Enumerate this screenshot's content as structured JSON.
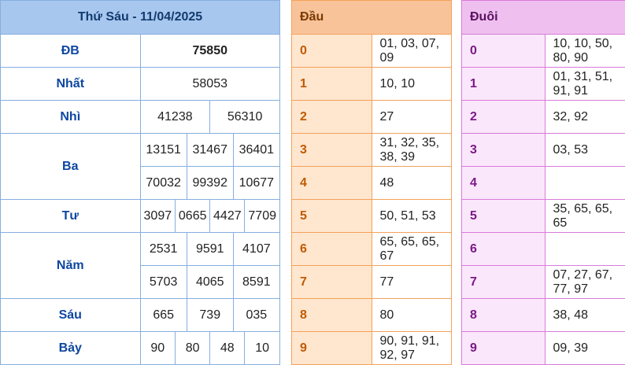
{
  "header": {
    "title": "Thứ Sáu - 11/04/2025"
  },
  "prizes": {
    "db": {
      "label": "ĐB",
      "values": [
        "75850"
      ]
    },
    "nhat": {
      "label": "Nhất",
      "values": [
        "58053"
      ]
    },
    "nhi": {
      "label": "Nhì",
      "values": [
        "41238",
        "56310"
      ]
    },
    "ba": {
      "label": "Ba",
      "values": [
        "13151",
        "31467",
        "36401",
        "70032",
        "99392",
        "10677"
      ]
    },
    "tu": {
      "label": "Tư",
      "values": [
        "3097",
        "0665",
        "4427",
        "7709"
      ]
    },
    "nam": {
      "label": "Năm",
      "values": [
        "2531",
        "9591",
        "4107",
        "5703",
        "4065",
        "8591"
      ]
    },
    "sau": {
      "label": "Sáu",
      "values": [
        "665",
        "739",
        "035"
      ]
    },
    "bay": {
      "label": "Bảy",
      "values": [
        "90",
        "80",
        "48",
        "10"
      ]
    }
  },
  "dau": {
    "title": "Đầu",
    "rows": [
      {
        "key": "0",
        "nums": "01, 03, 07, 09"
      },
      {
        "key": "1",
        "nums": "10, 10"
      },
      {
        "key": "2",
        "nums": "27"
      },
      {
        "key": "3",
        "nums": "31, 32, 35, 38, 39"
      },
      {
        "key": "4",
        "nums": "48"
      },
      {
        "key": "5",
        "nums": "50, 51, 53"
      },
      {
        "key": "6",
        "nums": "65, 65, 65, 67"
      },
      {
        "key": "7",
        "nums": "77"
      },
      {
        "key": "8",
        "nums": "80"
      },
      {
        "key": "9",
        "nums": "90, 91, 91, 92, 97"
      }
    ]
  },
  "duoi": {
    "title": "Đuôi",
    "rows": [
      {
        "key": "0",
        "nums": "10, 10, 50, 80, 90"
      },
      {
        "key": "1",
        "nums": "01, 31, 51, 91, 91"
      },
      {
        "key": "2",
        "nums": "32, 92"
      },
      {
        "key": "3",
        "nums": "03, 53"
      },
      {
        "key": "4",
        "nums": ""
      },
      {
        "key": "5",
        "nums": "35, 65, 65, 65"
      },
      {
        "key": "6",
        "nums": ""
      },
      {
        "key": "7",
        "nums": "07, 27, 67, 77, 97"
      },
      {
        "key": "8",
        "nums": "38, 48"
      },
      {
        "key": "9",
        "nums": "09, 39"
      }
    ]
  }
}
